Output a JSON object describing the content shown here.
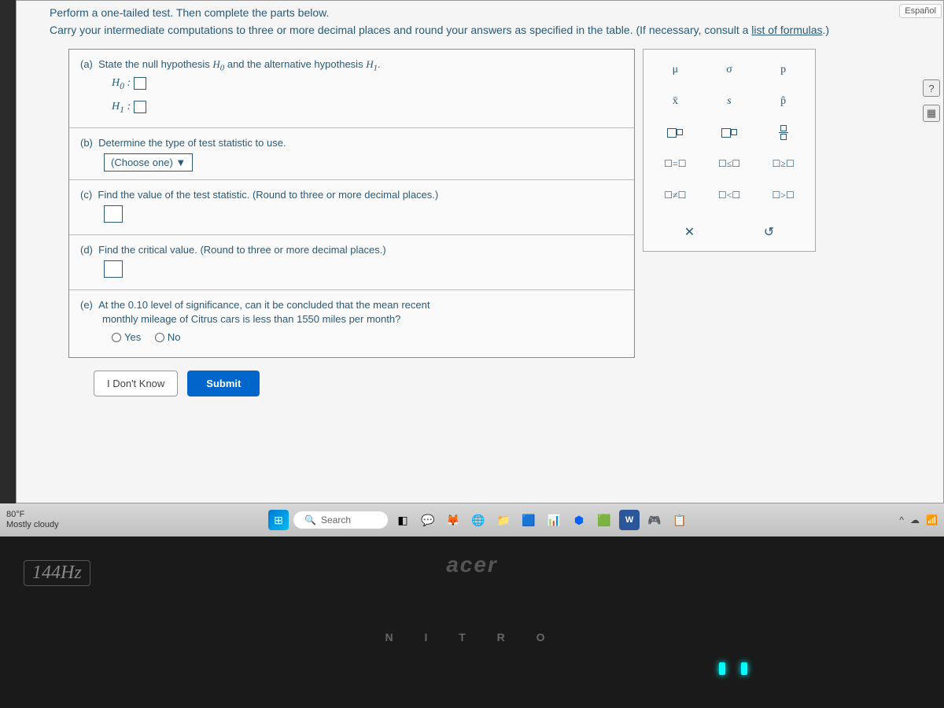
{
  "lang_button": "Español",
  "header": {
    "line1": "Perform a one-tailed test. Then complete the parts below.",
    "line2_pre": "Carry your intermediate computations to three or more decimal places and round your answers as specified in the table. (If necessary, consult a ",
    "link": "list of formulas",
    "line2_post": ".)"
  },
  "parts": {
    "a": {
      "label": "(a)",
      "text": "State the null hypothesis",
      "text2": "and the alternative hypothesis",
      "h0": "H",
      "h0sub": "0",
      "h1": "H",
      "h1sub": "1"
    },
    "b": {
      "label": "(b)",
      "text": "Determine the type of test statistic to use.",
      "dropdown": "(Choose one)"
    },
    "c": {
      "label": "(c)",
      "text": "Find the value of the test statistic. (Round to three or more decimal places.)"
    },
    "d": {
      "label": "(d)",
      "text": "Find the critical value. (Round to three or more decimal places.)"
    },
    "e": {
      "label": "(e)",
      "text1": "At the 0.10 level of significance, can it be concluded that the mean recent",
      "text2": "monthly mileage of Citrus cars is less than 1550 miles per month?",
      "yes": "Yes",
      "no": "No"
    }
  },
  "palette": {
    "r1": [
      "μ",
      "σ",
      "p"
    ],
    "r2": [
      "x̄",
      "s",
      "p̂"
    ],
    "r5": [
      "☐=☐",
      "☐≤☐",
      "☐≥☐"
    ],
    "r6": [
      "☐≠☐",
      "☐<☐",
      "☐>☐"
    ],
    "clear": "✕",
    "reset": "↺"
  },
  "buttons": {
    "idk": "I Don't Know",
    "submit": "Submit"
  },
  "taskbar": {
    "temp": "80°F",
    "cond": "Mostly cloudy",
    "search": "Search"
  },
  "laptop": {
    "hz": "144Hz",
    "brand": "acer",
    "model": "N I T R O"
  }
}
